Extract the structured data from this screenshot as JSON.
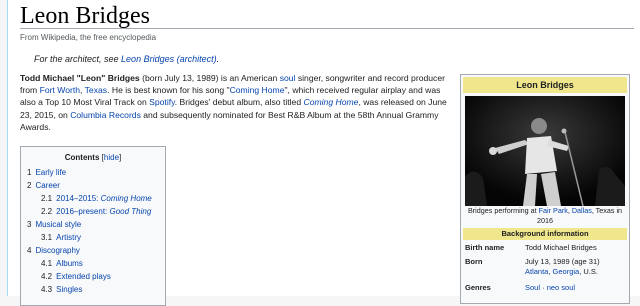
{
  "page": {
    "title": "Leon Bridges",
    "tagline": "From Wikipedia, the free encyclopedia"
  },
  "hatnote": {
    "prefix": "For the architect, see ",
    "link": "Leon Bridges (architect)",
    "suffix": "."
  },
  "lead": {
    "name": "Todd Michael \"Leon\" Bridges",
    "t1": " (born July 13, 1989) is an American ",
    "soul": "soul",
    "t2": " singer, songwriter and record producer from ",
    "fort_worth": "Fort Worth",
    "comma": ", ",
    "texas": "Texas",
    "t3": ". He is best known for his song \"",
    "coming_home_song": "Coming Home",
    "t4": "\", which received regular airplay and was also a Top 10 Most Viral Track on ",
    "spotify": "Spotify",
    "t5": ". Bridges' debut album, also titled ",
    "coming_home_album": "Coming Home",
    "t6": ", was released on June 23, 2015, on ",
    "columbia": "Columbia Records",
    "t7": " and subsequently nominated for Best R&B Album at the 58th Annual Grammy Awards."
  },
  "toc": {
    "title": "Contents",
    "hide_open": "[",
    "hide": "hide",
    "hide_close": "]",
    "items": [
      {
        "num": "1",
        "label": "Early life",
        "italic": ""
      },
      {
        "num": "2",
        "label": "Career",
        "italic": ""
      },
      {
        "num": "2.1",
        "label": "2014–2015: ",
        "italic": "Coming Home"
      },
      {
        "num": "2.2",
        "label": "2016–present: ",
        "italic": "Good Thing"
      },
      {
        "num": "3",
        "label": "Musical style",
        "italic": ""
      },
      {
        "num": "3.1",
        "label": "Artistry",
        "italic": ""
      },
      {
        "num": "4",
        "label": "Discography",
        "italic": ""
      },
      {
        "num": "4.1",
        "label": "Albums",
        "italic": ""
      },
      {
        "num": "4.2",
        "label": "Extended plays",
        "italic": ""
      },
      {
        "num": "4.3",
        "label": "Singles",
        "italic": ""
      }
    ]
  },
  "infobox": {
    "title": "Leon Bridges",
    "caption_pre": "Bridges performing at ",
    "caption_fair_park": "Fair Park",
    "caption_comma": ", ",
    "caption_dallas": "Dallas",
    "caption_post": ", Texas in 2016",
    "section": "Background information",
    "birth_name_label": "Birth name",
    "birth_name": "Todd Michael Bridges",
    "born_label": "Born",
    "born_date": "July 13, 1989 (age 31)",
    "born_city": "Atlanta",
    "born_comma": ", ",
    "born_state": "Georgia",
    "born_country": ", U.S.",
    "genres_label": "Genres",
    "genre_1": "Soul",
    "genre_sep": " · ",
    "genre_2": "neo soul"
  },
  "colors": {
    "link": "#0645ad",
    "infobox_header": "#f0e68c",
    "border": "#a2a9b1"
  }
}
